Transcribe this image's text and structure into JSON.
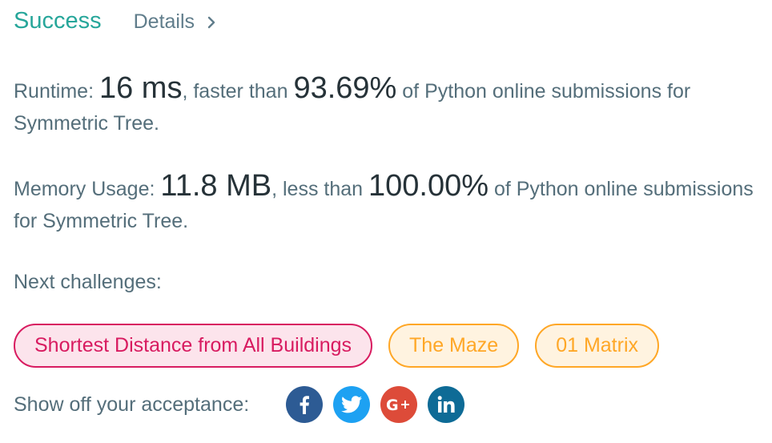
{
  "header": {
    "status": "Success",
    "details_label": "Details"
  },
  "runtime": {
    "label": "Runtime: ",
    "value": "16 ms",
    "connector": ", faster than ",
    "percent": "93.69%",
    "suffix": " of Python online submissions for Symmetric Tree."
  },
  "memory": {
    "label": "Memory Usage: ",
    "value": "11.8 MB",
    "connector": ", less than ",
    "percent": "100.00%",
    "suffix": " of Python online submissions for Symmetric Tree."
  },
  "next_challenges": {
    "label": "Next challenges:",
    "items": [
      {
        "title": "Shortest Distance from All Buildings"
      },
      {
        "title": "The Maze"
      },
      {
        "title": "01 Matrix"
      }
    ]
  },
  "share": {
    "label": "Show off your acceptance:",
    "networks": [
      {
        "icon": "facebook-icon",
        "color": "#2d5b94"
      },
      {
        "icon": "twitter-icon",
        "color": "#1da1f2"
      },
      {
        "icon": "google-plus-icon",
        "color": "#dd4b39"
      },
      {
        "icon": "linkedin-icon",
        "color": "#0e6b96"
      }
    ]
  },
  "colors": {
    "success": "#26a69a",
    "hard_chip": "#d81b60",
    "medium_chip": "#ffa726"
  }
}
